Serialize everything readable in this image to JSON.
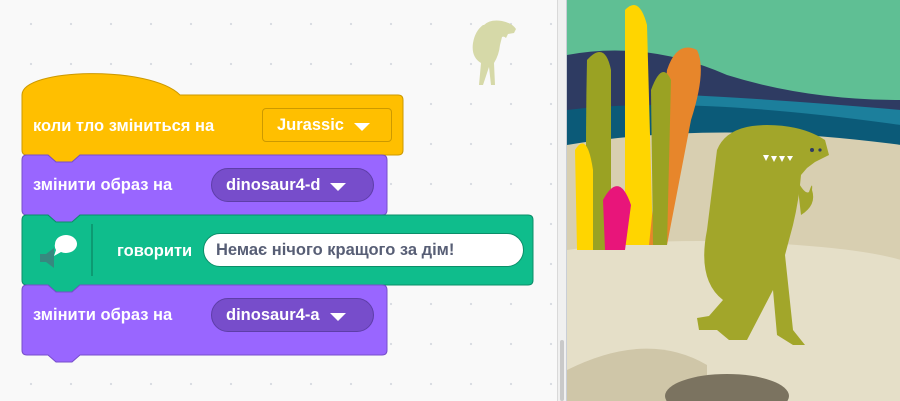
{
  "workspace": {
    "hat_block": {
      "label": "коли тло зміниться на",
      "backdrop_value": "Jurassic"
    },
    "costume_block_1": {
      "label": "змінити образ на",
      "costume_value": "dinosaur4-d"
    },
    "say_block": {
      "label": "говорити",
      "message": "Немає нічого кращого за дім!"
    },
    "costume_block_2": {
      "label": "змінити образ на",
      "costume_value": "dinosaur4-a"
    }
  },
  "colors": {
    "events": "#ffbf00",
    "looks": "#9966ff",
    "text_to_speech": "#0fbd8c",
    "stage_sky": "#5fbf94",
    "stage_ground": "#d8cfb1",
    "dinosaur": "#a2a62a"
  },
  "icons": {
    "extension": "speech-bubble-speaker-icon",
    "dropdown": "dropdown-arrow-icon",
    "sprite": "dinosaur-sprite-icon"
  }
}
